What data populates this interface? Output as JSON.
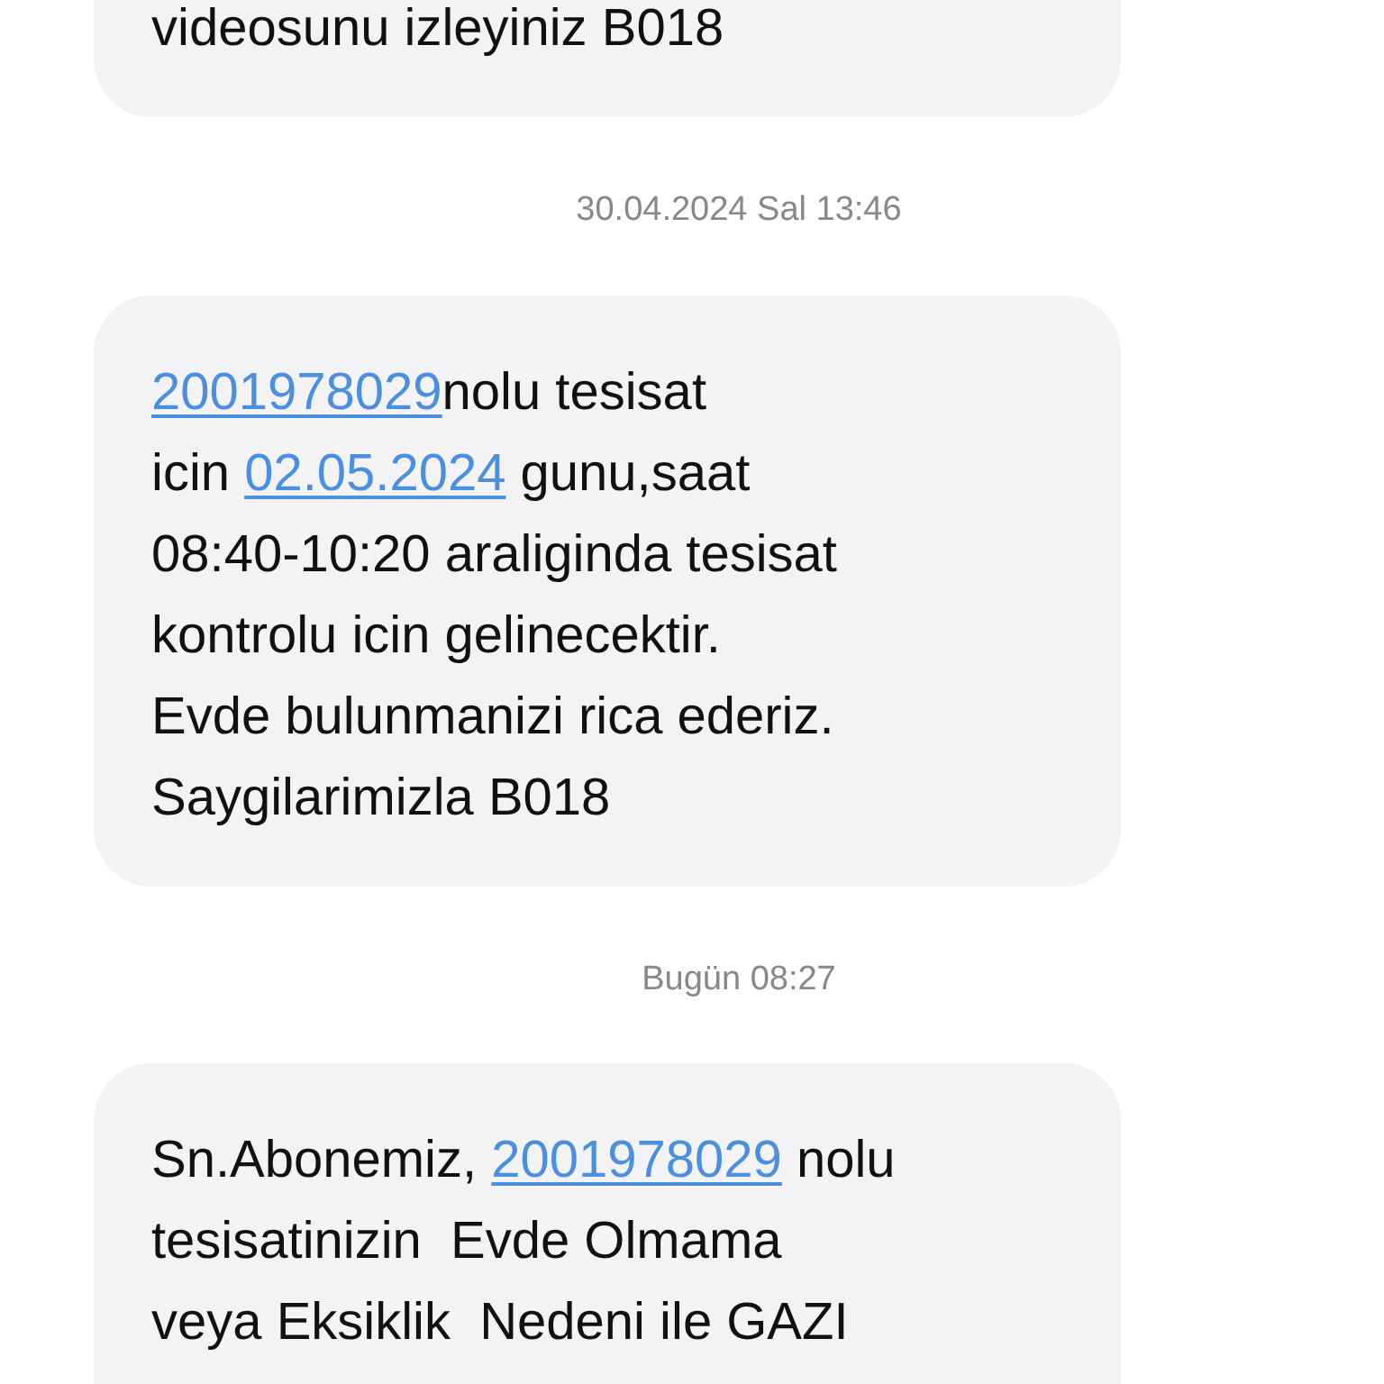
{
  "thread": [
    {
      "kind": "message",
      "lines": [
        [
          {
            "kind": "text",
            "text": "videosunu izleyiniz B018"
          }
        ]
      ]
    },
    {
      "kind": "timestamp",
      "text": "30.04.2024 Sal 13:46"
    },
    {
      "kind": "message",
      "lines": [
        [
          {
            "kind": "link",
            "text": "2001978029"
          },
          {
            "kind": "text",
            "text": "nolu tesisat"
          }
        ],
        [
          {
            "kind": "text",
            "text": "icin "
          },
          {
            "kind": "link",
            "text": "02.05.2024"
          },
          {
            "kind": "text",
            "text": " gunu,saat"
          }
        ],
        [
          {
            "kind": "text",
            "text": "08:40-10:20 araliginda tesisat"
          }
        ],
        [
          {
            "kind": "text",
            "text": "kontrolu icin gelinecektir."
          }
        ],
        [
          {
            "kind": "text",
            "text": "Evde bulunmanizi rica ederiz."
          }
        ],
        [
          {
            "kind": "text",
            "text": "Saygilarimizla B018"
          }
        ]
      ]
    },
    {
      "kind": "timestamp",
      "text": "Bugün 08:27"
    },
    {
      "kind": "message",
      "lines": [
        [
          {
            "kind": "text",
            "text": "Sn.Abonemiz, "
          },
          {
            "kind": "link",
            "text": "2001978029"
          },
          {
            "kind": "text",
            "text": " nolu"
          }
        ],
        [
          {
            "kind": "text",
            "text": "tesisatinizin  Evde Olmama"
          }
        ],
        [
          {
            "kind": "text",
            "text": "veya Eksiklik  Nedeni ile GAZI"
          }
        ]
      ]
    }
  ]
}
